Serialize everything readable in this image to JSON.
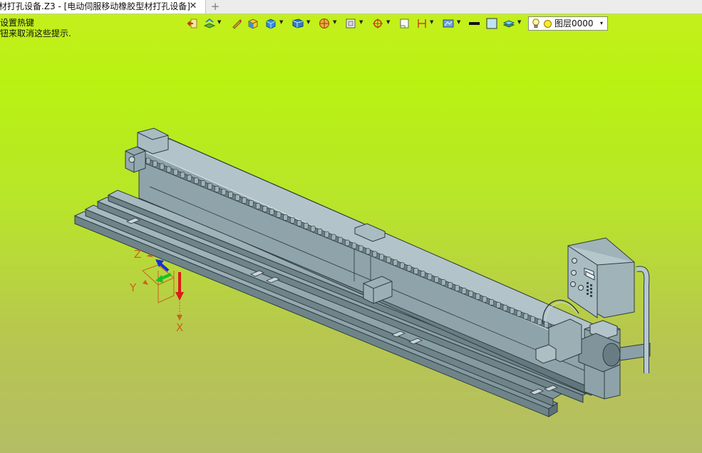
{
  "tab": {
    "title": "材打孔设备.Z3 - [电动伺服移动橡胶型材打孔设备]",
    "close": "✕",
    "add": "+"
  },
  "hints": [
    "设置热键",
    "钮来取消这些提示."
  ],
  "layer": {
    "label": "图层0000",
    "caret": "▾"
  },
  "axes": {
    "z": "Z",
    "y": "Y",
    "x": "X"
  },
  "colors": {
    "viewport_top": "#c6ef1e",
    "viewport_bottom": "#b4bd64",
    "model": "#8ea4aa",
    "model_edge": "#2f3b40"
  }
}
